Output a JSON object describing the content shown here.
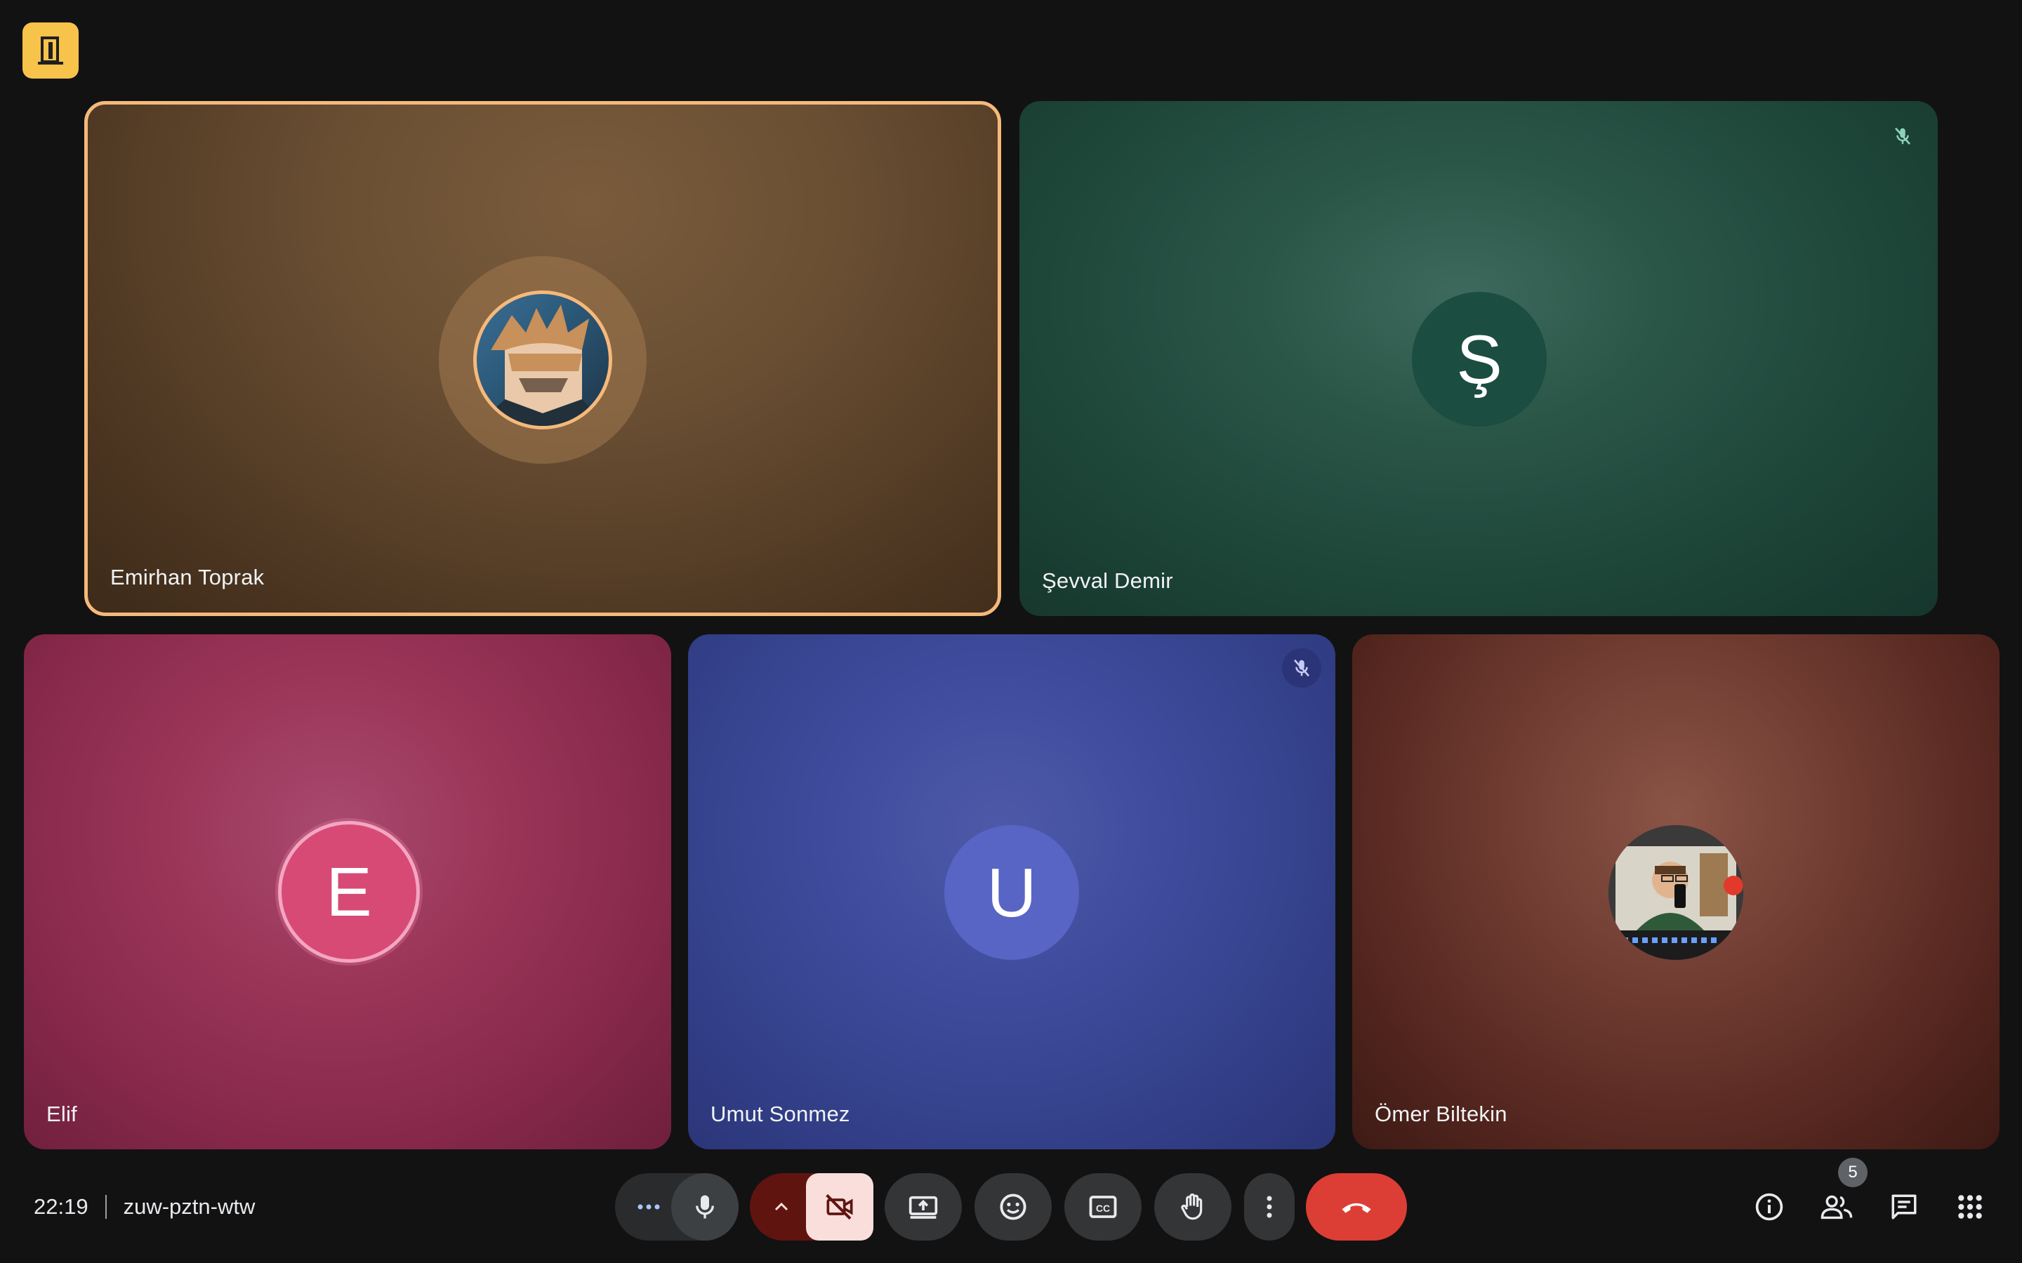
{
  "app": {
    "exit_icon": "door-exit-icon",
    "accent": "#f8c34b"
  },
  "tiles": {
    "emirhan": {
      "name": "Emirhan Toprak",
      "avatar": "anime-avatar",
      "speaking": true,
      "border": "#f5b97a"
    },
    "sevval": {
      "name": "Şevval Demir",
      "initial": "Ş",
      "muted": true,
      "color": "#1b4d40"
    },
    "elif": {
      "name": "Elif",
      "initial": "E",
      "color": "#d84a76"
    },
    "umut": {
      "name": "Umut Sonmez",
      "initial": "U",
      "muted": true,
      "color": "#5865c4"
    },
    "omer": {
      "name": "Ömer Biltekin",
      "avatar": "photo-avatar"
    }
  },
  "footer": {
    "time": "22:19",
    "meeting_code": "zuw-pztn-wtw"
  },
  "controls": {
    "more_audio_icon": "dots-horizontal-icon",
    "mic_icon": "microphone-icon",
    "camera_options_icon": "chevron-up-icon",
    "camera_icon": "camera-off-icon",
    "present_icon": "present-screen-icon",
    "emoji_icon": "emoji-icon",
    "captions_icon": "closed-captions-icon",
    "hand_icon": "raise-hand-icon",
    "more_icon": "more-vertical-icon",
    "leave_icon": "hang-up-icon",
    "leave_color": "#dc3e35"
  },
  "right_controls": {
    "info_icon": "info-icon",
    "people_icon": "people-icon",
    "people_count": "5",
    "chat_icon": "chat-icon",
    "activities_icon": "apps-grid-icon"
  }
}
